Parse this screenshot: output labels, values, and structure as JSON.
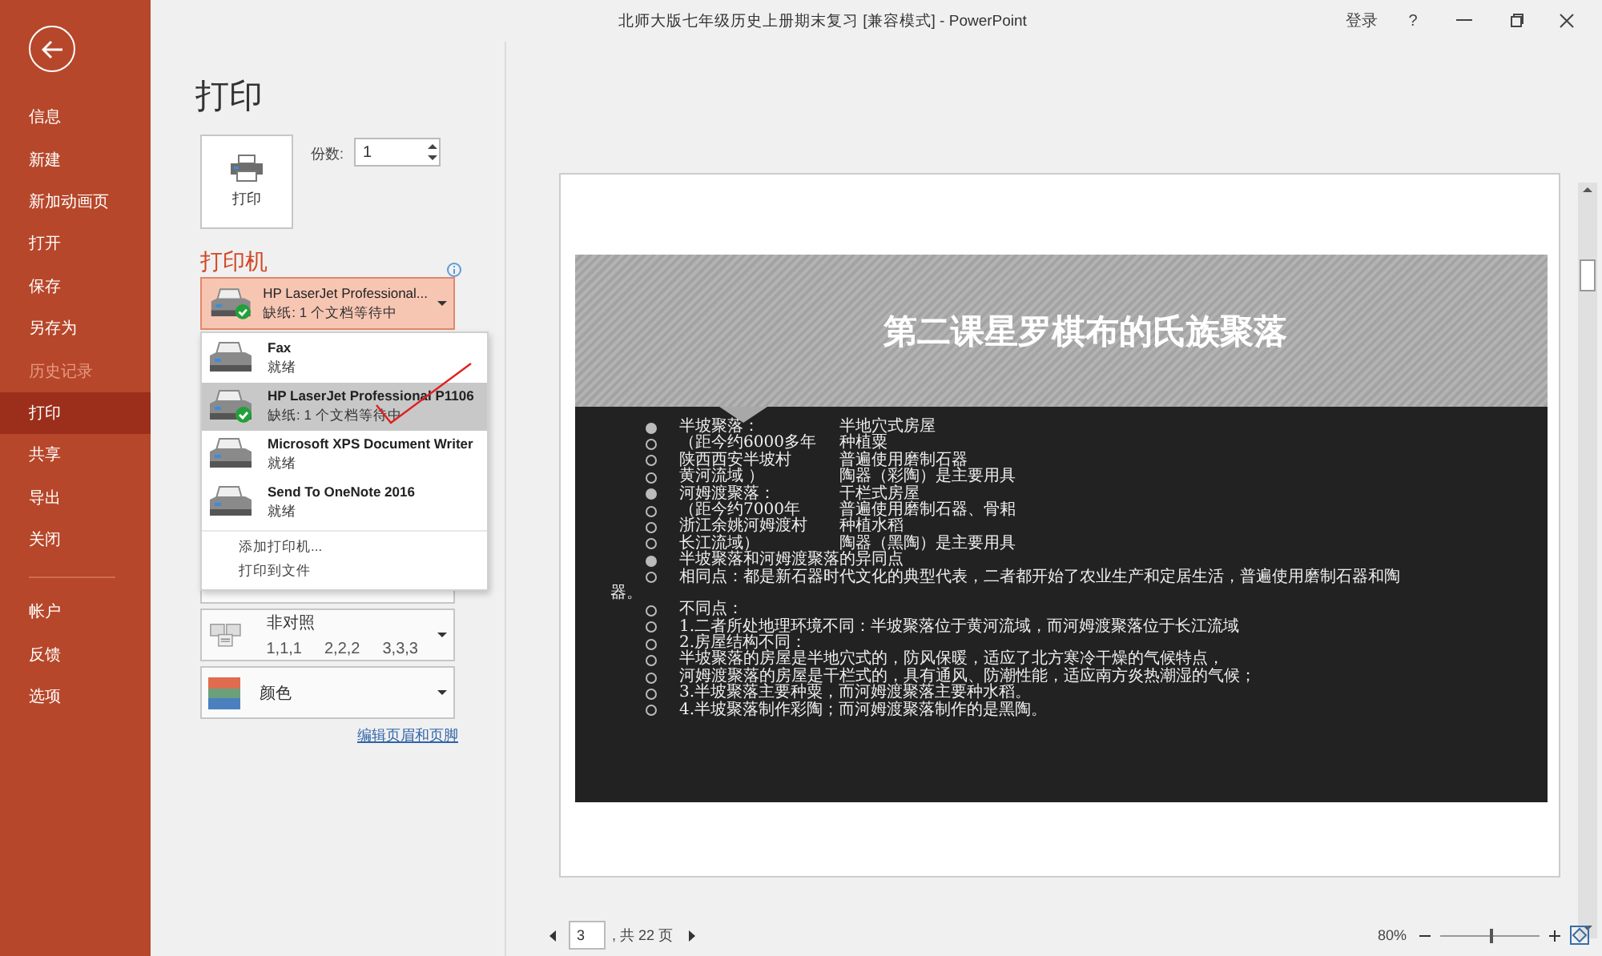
{
  "window": {
    "title": "北师大版七年级历史上册期末复习 [兼容模式]  -  PowerPoint",
    "sign_in": "登录",
    "help": "?"
  },
  "sidebar": {
    "items": [
      {
        "label": "信息",
        "selected": false,
        "disabled": false
      },
      {
        "label": "新建",
        "selected": false,
        "disabled": false
      },
      {
        "label": "新加动画页",
        "selected": false,
        "disabled": false
      },
      {
        "label": "打开",
        "selected": false,
        "disabled": false
      },
      {
        "label": "保存",
        "selected": false,
        "disabled": false
      },
      {
        "label": "另存为",
        "selected": false,
        "disabled": false
      },
      {
        "label": "历史记录",
        "selected": false,
        "disabled": true
      },
      {
        "label": "打印",
        "selected": true,
        "disabled": false
      },
      {
        "label": "共享",
        "selected": false,
        "disabled": false
      },
      {
        "label": "导出",
        "selected": false,
        "disabled": false
      },
      {
        "label": "关闭",
        "selected": false,
        "disabled": false
      }
    ],
    "bottom_items": [
      {
        "label": "帐户",
        "selected": false,
        "disabled": false
      },
      {
        "label": "反馈",
        "selected": false,
        "disabled": false
      },
      {
        "label": "选项",
        "selected": false,
        "disabled": false
      }
    ]
  },
  "print": {
    "heading": "打印",
    "button": "打印",
    "copies_label": "份数:",
    "copies": "1"
  },
  "printer": {
    "heading": "打印机",
    "current": {
      "name": "HP LaserJet Professional...",
      "status": "缺纸: 1 个文档等待中",
      "ready": true
    },
    "menu": {
      "printers": [
        {
          "name": "Fax",
          "status": "就绪",
          "selected": false,
          "ready": false
        },
        {
          "name": "HP LaserJet Professional P1106",
          "status": "缺纸: 1 个文档等待中",
          "selected": true,
          "ready": true
        },
        {
          "name": "Microsoft XPS Document Writer",
          "status": "就绪",
          "selected": false,
          "ready": false
        },
        {
          "name": "Send To OneNote 2016",
          "status": "就绪",
          "selected": false,
          "ready": false
        }
      ],
      "actions": [
        "添加打印机...",
        "打印到文件"
      ]
    }
  },
  "settings": {
    "collate": {
      "title": "非对照",
      "values": [
        "1,1,1",
        "2,2,2",
        "3,3,3"
      ]
    },
    "color": {
      "title": "颜色"
    },
    "link": "编辑页眉和页脚"
  },
  "slide": {
    "title": "第二课星罗棋布的氏族聚落",
    "lines": [
      {
        "kind": "filled",
        "text": "半坡聚落：",
        "col2": "半地穴式房屋"
      },
      {
        "kind": "hollow",
        "text": "（距今约6000多年",
        "col2": "种植粟"
      },
      {
        "kind": "hollow",
        "text": "陕西西安半坡村",
        "col2": "普遍使用磨制石器"
      },
      {
        "kind": "hollow",
        "text": "黄河流域 ）",
        "col2": "陶器（彩陶）是主要用具"
      },
      {
        "kind": "filled",
        "text": "河姆渡聚落：",
        "col2": "干栏式房屋"
      },
      {
        "kind": "hollow",
        "text": "（距今约7000年",
        "col2": "普遍使用磨制石器、骨耜"
      },
      {
        "kind": "hollow",
        "text": "浙江余姚河姆渡村",
        "col2": "种植水稻"
      },
      {
        "kind": "hollow",
        "text": "长江流域）",
        "col2": "陶器（黑陶）是主要用具"
      },
      {
        "kind": "filled",
        "text": "半坡聚落和河姆渡聚落的异同点"
      },
      {
        "kind": "hollow",
        "text": "相同点：都是新石器时代文化的典型代表，二者都开始了农业生产和定居生活，普遍使用磨制石器和陶"
      },
      {
        "kind": "plain",
        "text": "器。"
      },
      {
        "kind": "hollow",
        "text": "不同点："
      },
      {
        "kind": "hollow",
        "text": "1.二者所处地理环境不同：半坡聚落位于黄河流域，而河姆渡聚落位于长江流域"
      },
      {
        "kind": "hollow",
        "text": "2.房屋结构不同："
      },
      {
        "kind": "hollow",
        "text": "半坡聚落的房屋是半地穴式的，防风保暖，适应了北方寒冷干燥的气候特点，"
      },
      {
        "kind": "hollow",
        "text": "河姆渡聚落的房屋是干栏式的，具有通风、防潮性能，适应南方炎热潮湿的气候；"
      },
      {
        "kind": "hollow",
        "text": "3.半坡聚落主要种粟，而河姆渡聚落主要种水稻。"
      },
      {
        "kind": "hollow",
        "text": "4.半坡聚落制作彩陶；而河姆渡聚落制作的是黑陶。"
      }
    ]
  },
  "status_bar": {
    "page": "3",
    "page_total": ", 共 22 页",
    "zoom": "80%",
    "zoom_slider": {
      "level": 0.5
    }
  }
}
